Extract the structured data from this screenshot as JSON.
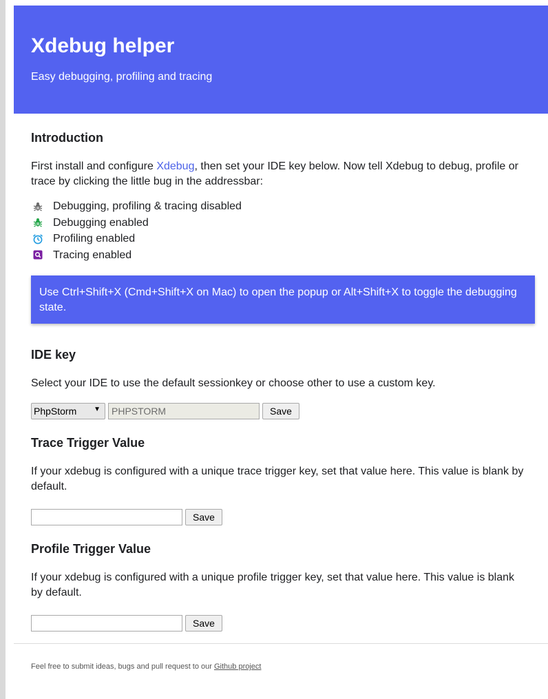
{
  "header": {
    "title": "Xdebug helper",
    "subtitle": "Easy debugging, profiling and tracing"
  },
  "intro": {
    "heading": "Introduction",
    "text_before_link": "First install and configure ",
    "link_text": "Xdebug",
    "text_after_link": ", then set your IDE key below. Now tell Xdebug to debug, profile or trace by clicking the little bug in the addressbar:",
    "states": [
      {
        "icon": "bug-gray-icon",
        "label": "Debugging, profiling & tracing disabled"
      },
      {
        "icon": "bug-green-icon",
        "label": "Debugging enabled"
      },
      {
        "icon": "alarm-clock-icon",
        "label": "Profiling enabled"
      },
      {
        "icon": "magnifier-icon",
        "label": "Tracing enabled"
      }
    ],
    "hint": "Use Ctrl+Shift+X (Cmd+Shift+X on Mac) to open the popup or Alt+Shift+X to toggle the debugging state."
  },
  "ide": {
    "heading": "IDE key",
    "text": "Select your IDE to use the default sessionkey or choose other to use a custom key.",
    "selected": "PhpStorm",
    "key_value": "PHPSTORM",
    "save_label": "Save"
  },
  "trace": {
    "heading": "Trace Trigger Value",
    "text": "If your xdebug is configured with a unique trace trigger key, set that value here. This value is blank by default.",
    "value": "",
    "save_label": "Save"
  },
  "profile": {
    "heading": "Profile Trigger Value",
    "text": "If your xdebug is configured with a unique profile trigger key, set that value here. This value is blank by default.",
    "value": "",
    "save_label": "Save"
  },
  "footer": {
    "text": "Feel free to submit ideas, bugs and pull request to our ",
    "link_text": "Github project"
  },
  "colors": {
    "header_bg": "#5362f0",
    "link": "#4d63e8",
    "bug_gray": "#6b6b6b",
    "bug_green": "#22a548",
    "clock": "#1e9be0",
    "trace": "#7b1fa2"
  }
}
